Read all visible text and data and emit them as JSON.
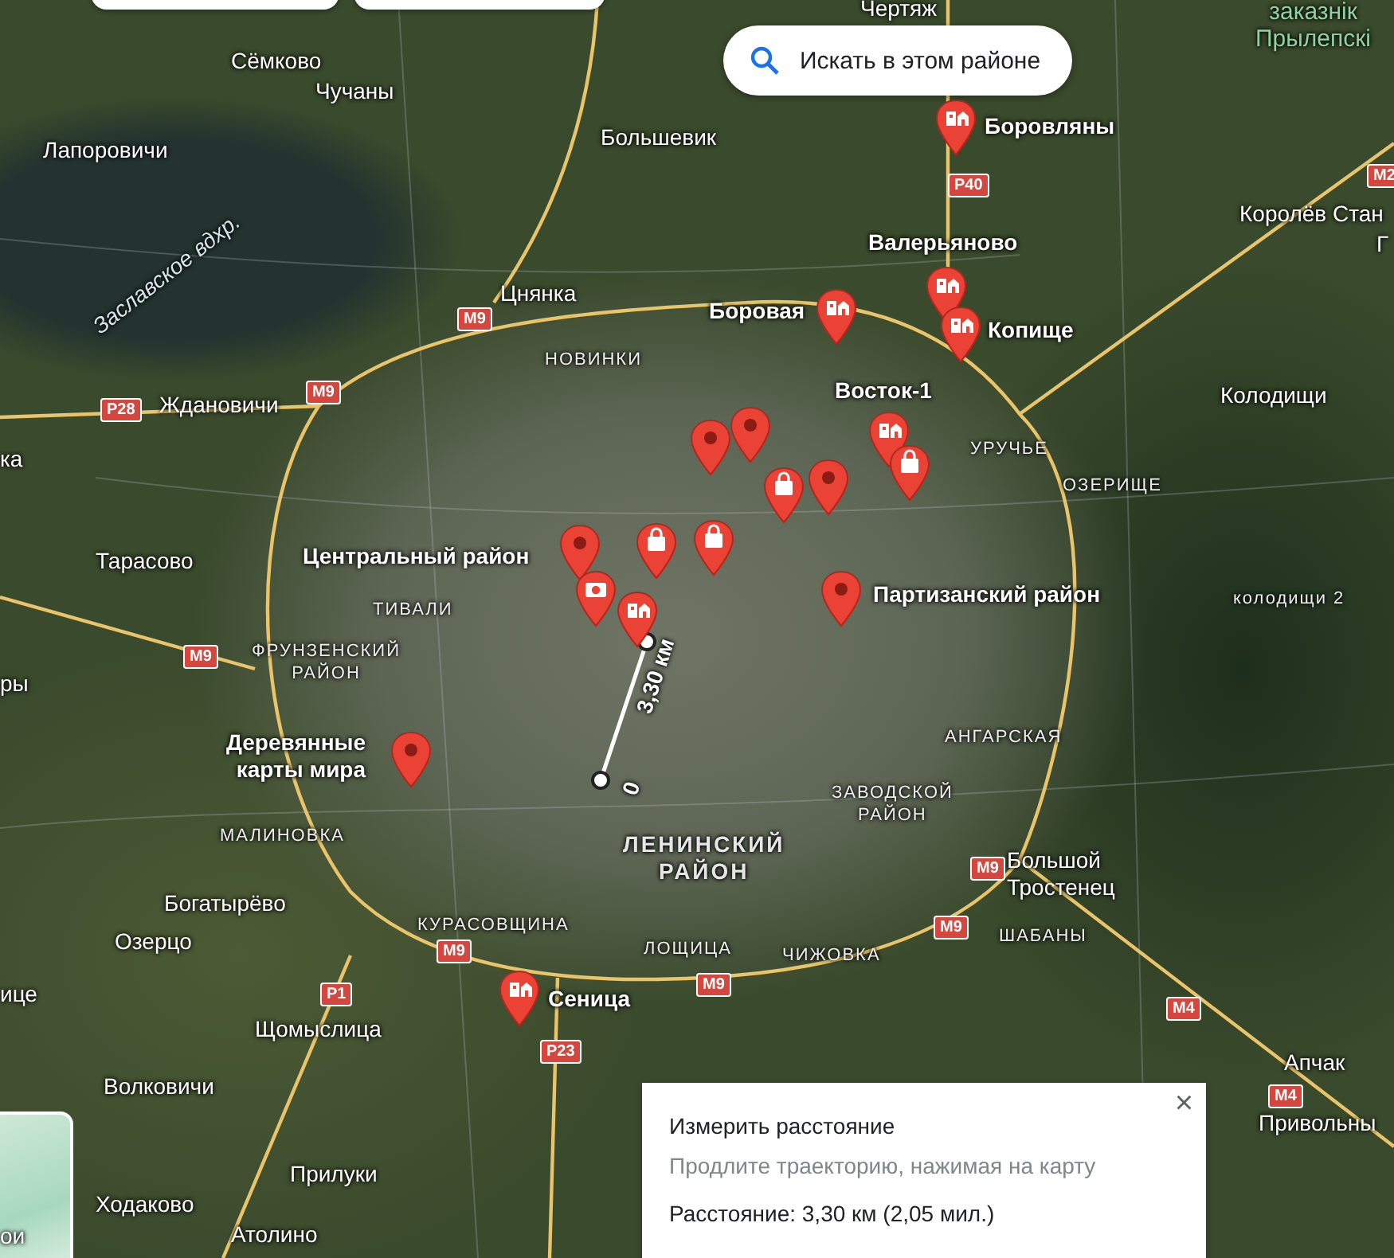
{
  "map": {
    "labels": [
      {
        "kind": "place",
        "text": "Чертяж"
      },
      {
        "kind": "reserve",
        "text": "заказнік\nПрылепскі"
      },
      {
        "kind": "place",
        "text": "Сёмково"
      },
      {
        "kind": "place",
        "text": "Чучаны"
      },
      {
        "kind": "place",
        "text": "Лапоровичи"
      },
      {
        "kind": "place",
        "text": "Большевик"
      },
      {
        "kind": "poi",
        "text": "Боровляны"
      },
      {
        "kind": "place",
        "text": "Королёв Стан"
      },
      {
        "kind": "place",
        "text": "Г"
      },
      {
        "kind": "lake",
        "text": "Заславское вдхр."
      },
      {
        "kind": "poi",
        "text": "Валерьяново"
      },
      {
        "kind": "place",
        "text": "Цнянка"
      },
      {
        "kind": "poi",
        "text": "Боровая"
      },
      {
        "kind": "poi",
        "text": "Копище"
      },
      {
        "kind": "district",
        "text": "НОВИНКИ"
      },
      {
        "kind": "poi",
        "text": "Восток-1"
      },
      {
        "kind": "place",
        "text": "Колодищи"
      },
      {
        "kind": "place",
        "text": "Ждановичи"
      },
      {
        "kind": "place",
        "text": "ка"
      },
      {
        "kind": "district",
        "text": "УРУЧЬЕ"
      },
      {
        "kind": "district",
        "text": "ОЗЕРИЩЕ"
      },
      {
        "kind": "place",
        "text": "Тарасово"
      },
      {
        "kind": "poi",
        "text": "Центральный район"
      },
      {
        "kind": "poi",
        "text": "Партизанский район"
      },
      {
        "kind": "district",
        "text": "ТИВАЛИ"
      },
      {
        "kind": "district",
        "text": "колодищи 2"
      },
      {
        "kind": "district",
        "text": "ФРУНЗЕНСКИЙ\nРАЙОН"
      },
      {
        "kind": "place",
        "text": "ры"
      },
      {
        "kind": "district",
        "text": "АНГАРСКАЯ"
      },
      {
        "kind": "poi",
        "text": "Деревянные\nкарты мира"
      },
      {
        "kind": "district",
        "text": "ЗАВОДСКОЙ\nРАЙОН"
      },
      {
        "kind": "district",
        "text": "МАЛИНОВКА"
      },
      {
        "kind": "big",
        "text": "ЛЕНИНСКИЙ\nРАЙОН"
      },
      {
        "kind": "place",
        "text": "Большой\nТростенец"
      },
      {
        "kind": "place",
        "text": "Богатырёво"
      },
      {
        "kind": "district",
        "text": "КУРАСОВЩИНА"
      },
      {
        "kind": "place",
        "text": "Озерцо"
      },
      {
        "kind": "district",
        "text": "ЛОЩИЦА"
      },
      {
        "kind": "district",
        "text": "ЧИЖОВКА"
      },
      {
        "kind": "district",
        "text": "ШАБАНЫ"
      },
      {
        "kind": "place",
        "text": "ице"
      },
      {
        "kind": "poi",
        "text": "Сеница"
      },
      {
        "kind": "place",
        "text": "Щомыслица"
      },
      {
        "kind": "place",
        "text": "Апчак"
      },
      {
        "kind": "place",
        "text": "Волковичи"
      },
      {
        "kind": "place",
        "text": "Привольны"
      },
      {
        "kind": "place",
        "text": "Прилуки"
      },
      {
        "kind": "place",
        "text": "Ходаково"
      },
      {
        "kind": "place",
        "text": "ои"
      },
      {
        "kind": "place",
        "text": "Атолино"
      }
    ],
    "roads": [
      "M9",
      "M9",
      "P28",
      "P40",
      "M2",
      "M9",
      "M9",
      "M9",
      "M9",
      "M9",
      "P1",
      "P23",
      "M4",
      "M4"
    ],
    "pins": [
      {
        "kind": "store"
      },
      {
        "kind": "store"
      },
      {
        "kind": "store"
      },
      {
        "kind": "store"
      },
      {
        "kind": "dot"
      },
      {
        "kind": "dot"
      },
      {
        "kind": "store"
      },
      {
        "kind": "bag"
      },
      {
        "kind": "bag"
      },
      {
        "kind": "dot"
      },
      {
        "kind": "dot"
      },
      {
        "kind": "bag"
      },
      {
        "kind": "bag"
      },
      {
        "kind": "camera"
      },
      {
        "kind": "store"
      },
      {
        "kind": "dot"
      },
      {
        "kind": "dot"
      },
      {
        "kind": "store"
      }
    ],
    "measure": {
      "distance_label": "3,30 км",
      "start_label": "0"
    }
  },
  "search_area_button": "Искать в этом районе",
  "measure_panel": {
    "title": "Измерить расстояние",
    "hint": "Продлите траекторию, нажимая на карту",
    "distance": "Расстояние: 3,30 км (2,05 мил.)",
    "close": "×"
  }
}
